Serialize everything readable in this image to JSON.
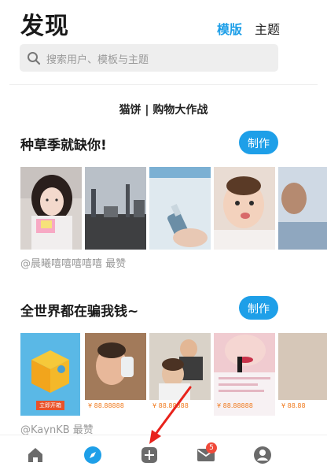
{
  "header": {
    "title": "发现",
    "tabs": [
      {
        "label": "模版",
        "active": true
      },
      {
        "label": "主题",
        "active": false
      }
    ],
    "search": {
      "placeholder": "搜索用户、模板与主题",
      "icon": "search-icon"
    }
  },
  "banner": {
    "text": "猫饼 | 购物大作战"
  },
  "sections": [
    {
      "title": "种草季就缺你!",
      "make_label": "制作",
      "byline": "@晨曦嘻嘻嘻嘻嘻 最赞"
    },
    {
      "title": "全世界都在骗我钱~",
      "make_label": "制作",
      "byline": "@KaynKB 最赞"
    }
  ],
  "thumb_text": {
    "open_now": "立即开箱",
    "price": "¥ 88.88888",
    "price_short": "¥ 88.88"
  },
  "tabbar": {
    "items": [
      {
        "name": "home-icon"
      },
      {
        "name": "compass-icon",
        "active": true
      },
      {
        "name": "add-icon"
      },
      {
        "name": "mail-icon",
        "badge": "5"
      },
      {
        "name": "profile-icon"
      }
    ]
  },
  "colors": {
    "accent": "#1e9fe8",
    "badge": "#f04a3a",
    "annotation_arrow": "#e8221b"
  }
}
